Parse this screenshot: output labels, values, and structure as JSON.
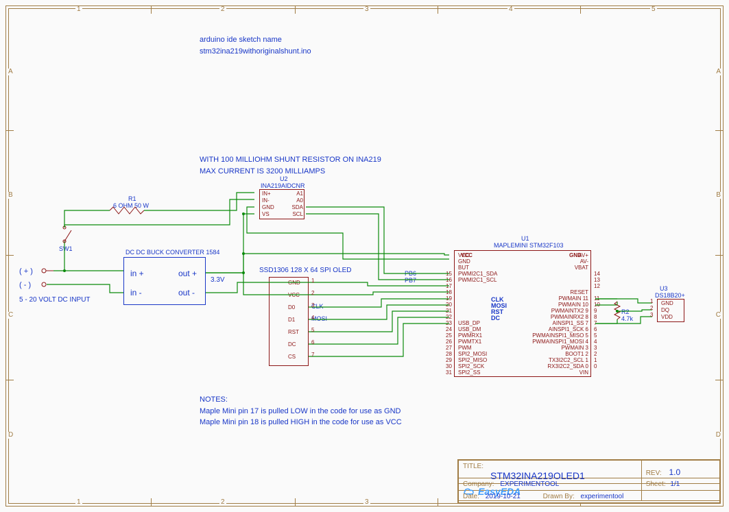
{
  "notes": {
    "sketch_title": "arduino  ide sketch name",
    "sketch_file": "stm32ina219withoriginalshunt.ino",
    "shunt1": "WITH 100 MILLIOHM SHUNT RESISTOR ON INA219",
    "shunt2": "MAX CURRENT IS 3200 MILLIAMPS",
    "notes_hdr": "NOTES:",
    "note1": "Maple Mini pin 17 is pulled LOW in the code for use as GND",
    "note2": "Maple Mini pin 18 is pulled HIGH in the code for use as VCC"
  },
  "input": {
    "pos": "( + )",
    "neg": "( - )",
    "caption": "5 - 20 VOLT DC INPUT"
  },
  "sw1": {
    "ref": "SW1"
  },
  "r1": {
    "ref": "R1",
    "value": "6 OHM 50 W"
  },
  "r2": {
    "ref": "R2",
    "value": "4.7k"
  },
  "buck": {
    "title": "DC DC BUCK CONVERTER 1584",
    "in_p": "in +",
    "in_n": "in -",
    "out_p": "out +",
    "out_n": "out -",
    "vout": "3.3V"
  },
  "u2": {
    "ref": "U2",
    "part": "INA219AIDCNR",
    "pins": {
      "inp": "IN+",
      "inn": "IN-",
      "gnd": "GND",
      "vs": "VS",
      "a1": "A1",
      "a0": "A0",
      "sda": "SDA",
      "scl": "SCL"
    }
  },
  "oled": {
    "title": "SSD1306 128 X 64 SPI OLED",
    "pins": {
      "gnd": "GND",
      "vcc": "VCC",
      "d0": "D0",
      "d1": "D1",
      "rst": "RST",
      "dc": "DC",
      "cs": "CS"
    },
    "pin_nums": [
      "1",
      "2",
      "3",
      "4",
      "5",
      "6",
      "7"
    ],
    "sig_clk": "CLK",
    "sig_mosi": "MOSI"
  },
  "u1": {
    "ref": "U1",
    "part": "MAPLEMINI STM32F103",
    "left": [
      {
        "n": "",
        "t": "VCC"
      },
      {
        "n": "",
        "t": "GND"
      },
      {
        "n": "",
        "t": "BUT"
      },
      {
        "n": "15",
        "t": "PWMI2C1_SDA"
      },
      {
        "n": "16",
        "t": "PWMI2C1_SCL"
      },
      {
        "n": "17",
        "t": ""
      },
      {
        "n": "18",
        "t": ""
      },
      {
        "n": "19",
        "t": ""
      },
      {
        "n": "20",
        "t": ""
      },
      {
        "n": "21",
        "t": ""
      },
      {
        "n": "22",
        "t": ""
      },
      {
        "n": "23",
        "t": "USB_DP"
      },
      {
        "n": "24",
        "t": "USB_DM"
      },
      {
        "n": "25",
        "t": "PWMRX1"
      },
      {
        "n": "26",
        "t": "PWMTX1"
      },
      {
        "n": "27",
        "t": "PWM"
      },
      {
        "n": "28",
        "t": "SPI2_MOSI"
      },
      {
        "n": "29",
        "t": "SPI2_MISO"
      },
      {
        "n": "30",
        "t": "SPI2_SCK"
      },
      {
        "n": "31",
        "t": "SPI2_SS"
      }
    ],
    "right": [
      {
        "n": "",
        "t": "AV+"
      },
      {
        "n": "",
        "t": "AV-"
      },
      {
        "n": "",
        "t": "VBAT"
      },
      {
        "n": "14",
        "t": ""
      },
      {
        "n": "13",
        "t": ""
      },
      {
        "n": "12",
        "t": ""
      },
      {
        "n": "",
        "t": "RESET"
      },
      {
        "n": "11",
        "t": "PWMAIN 11"
      },
      {
        "n": "10",
        "t": "PWMAIN 10"
      },
      {
        "n": "9",
        "t": "PWMAINTX2 9"
      },
      {
        "n": "8",
        "t": "PWMAINRX2 8"
      },
      {
        "n": "7",
        "t": "AINSPI1_SS 7"
      },
      {
        "n": "6",
        "t": "AINSPI1_SCK 6"
      },
      {
        "n": "5",
        "t": "PWMAINSPI1_MISO 5"
      },
      {
        "n": "4",
        "t": "PWMAINSPI1_MOSI 4"
      },
      {
        "n": "3",
        "t": "PWMAIN 3"
      },
      {
        "n": "2",
        "t": "BOOT1 2"
      },
      {
        "n": "1",
        "t": "TX3I2C2_SCL 1"
      },
      {
        "n": "0",
        "t": "RX3I2C2_SDA 0"
      },
      {
        "n": "",
        "t": "VIN"
      }
    ],
    "top": {
      "vcc": "VCC",
      "gnd": "GND"
    },
    "sigs": {
      "clk": "CLK",
      "mosi": "MOSI",
      "rst": "RST",
      "dc": "DC"
    },
    "nets": {
      "pb6": "PB6",
      "pb7": "PB7"
    }
  },
  "u3": {
    "ref": "U3",
    "part": "DS18B20+",
    "pins": {
      "gnd": "GND",
      "dq": "DQ",
      "vdd": "VDD"
    },
    "pin_nums": [
      "1",
      "2",
      "3"
    ]
  },
  "titleblock": {
    "title_lbl": "TITLE:",
    "title": "STM32INA219OLED1",
    "rev_lbl": "REV:",
    "rev": "1.0",
    "company_lbl": "Company:",
    "company": "EXPERIMENTOOL",
    "sheet_lbl": "Sheet:",
    "sheet": "1/1",
    "date_lbl": "Date:",
    "date": "2019-10-21",
    "drawn_lbl": "Drawn By:",
    "drawn": "experimentool",
    "brand": "EasyEDA"
  },
  "grid": {
    "cols": [
      "1",
      "2",
      "3",
      "4",
      "5"
    ],
    "rows": [
      "A",
      "B",
      "C",
      "D"
    ]
  }
}
